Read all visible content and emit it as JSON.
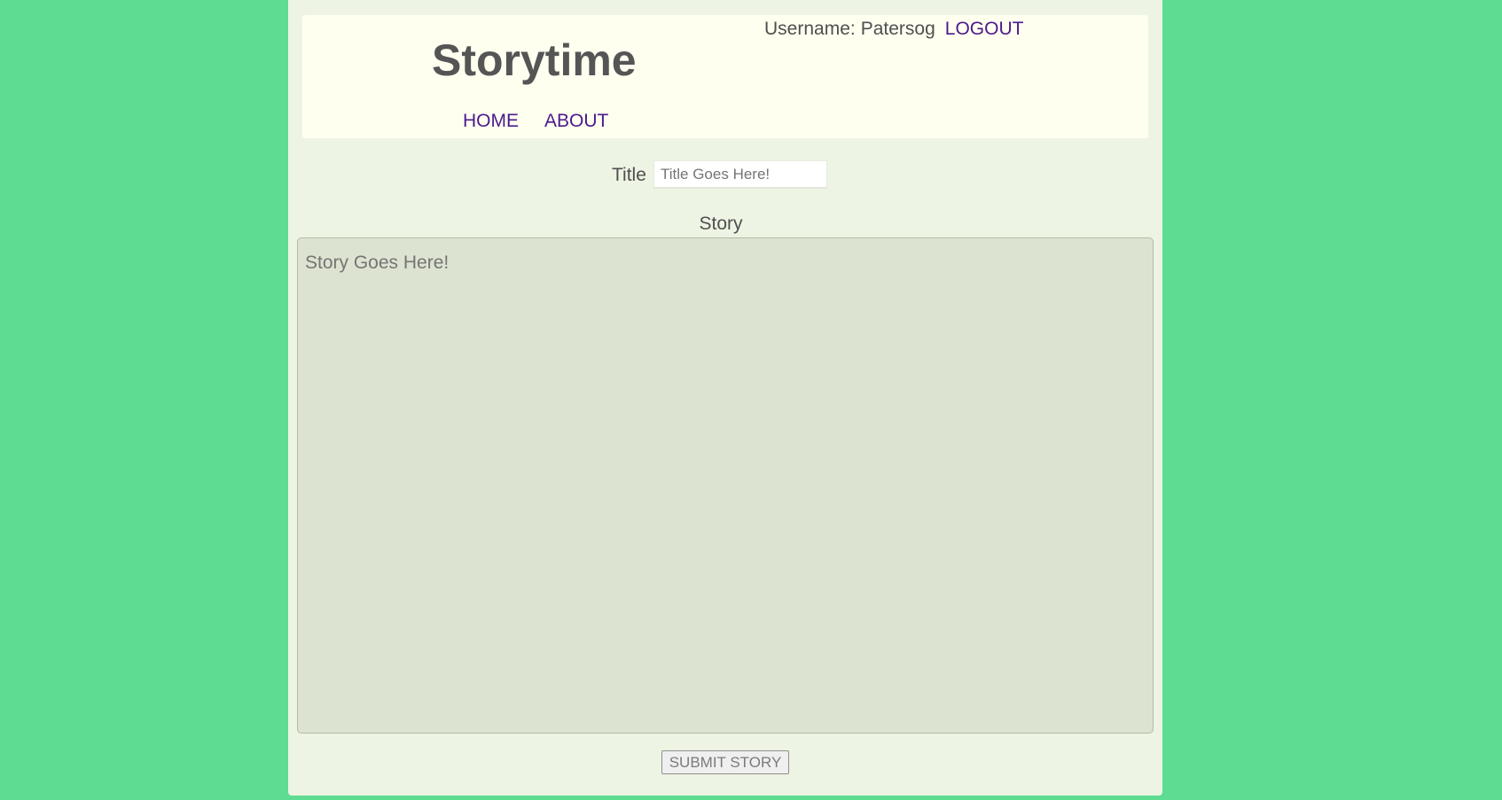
{
  "header": {
    "site_title": "Storytime",
    "username_label": "Username:",
    "username_value": "Patersog",
    "logout_label": "LOGOUT",
    "nav": [
      {
        "label": "HOME"
      },
      {
        "label": "ABOUT"
      }
    ]
  },
  "form": {
    "title_label": "Title",
    "title_value": "",
    "title_placeholder": "Title Goes Here!",
    "story_label": "Story",
    "story_value": "",
    "story_placeholder": "Story Goes Here!",
    "submit_label": "SUBMIT STORY"
  },
  "colors": {
    "background": "#5edc92",
    "page": "#edf4e3",
    "header": "#fffff0",
    "link": "#4b1a8c",
    "text": "#555555",
    "textarea": "#dce3d0"
  }
}
